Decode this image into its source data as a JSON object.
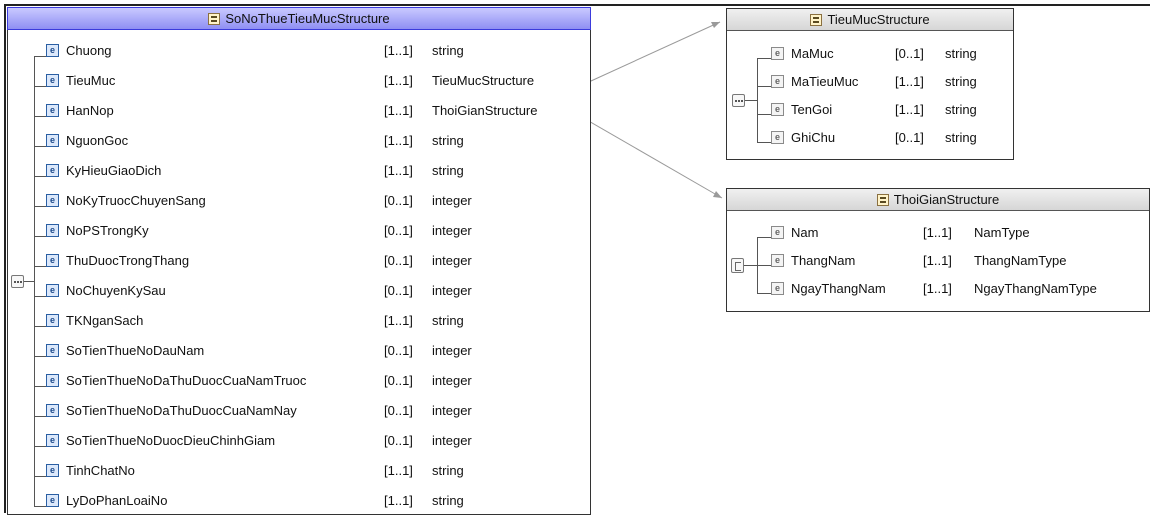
{
  "main": {
    "title": "SoNoThueTieuMucStructure",
    "elements": [
      {
        "name": "Chuong",
        "card": "[1..1]",
        "type": "string"
      },
      {
        "name": "TieuMuc",
        "card": "[1..1]",
        "type": "TieuMucStructure"
      },
      {
        "name": "HanNop",
        "card": "[1..1]",
        "type": "ThoiGianStructure"
      },
      {
        "name": "NguonGoc",
        "card": "[1..1]",
        "type": "string"
      },
      {
        "name": "KyHieuGiaoDich",
        "card": "[1..1]",
        "type": "string"
      },
      {
        "name": "NoKyTruocChuyenSang",
        "card": "[0..1]",
        "type": "integer"
      },
      {
        "name": "NoPSTrongKy",
        "card": "[0..1]",
        "type": "integer"
      },
      {
        "name": "ThuDuocTrongThang",
        "card": "[0..1]",
        "type": "integer"
      },
      {
        "name": "NoChuyenKySau",
        "card": "[0..1]",
        "type": "integer"
      },
      {
        "name": "TKNganSach",
        "card": "[1..1]",
        "type": "string"
      },
      {
        "name": "SoTienThueNoDauNam",
        "card": "[0..1]",
        "type": "integer"
      },
      {
        "name": "SoTienThueNoDaThuDuocCuaNamTruoc",
        "card": "[0..1]",
        "type": "integer"
      },
      {
        "name": "SoTienThueNoDaThuDuocCuaNamNay",
        "card": "[0..1]",
        "type": "integer"
      },
      {
        "name": "SoTienThueNoDuocDieuChinhGiam",
        "card": "[0..1]",
        "type": "integer"
      },
      {
        "name": "TinhChatNo",
        "card": "[1..1]",
        "type": "string"
      },
      {
        "name": "LyDoPhanLoaiNo",
        "card": "[1..1]",
        "type": "string"
      }
    ]
  },
  "tieumuc": {
    "title": "TieuMucStructure",
    "elements": [
      {
        "name": "MaMuc",
        "card": "[0..1]",
        "type": "string"
      },
      {
        "name": "MaTieuMuc",
        "card": "[1..1]",
        "type": "string"
      },
      {
        "name": "TenGoi",
        "card": "[1..1]",
        "type": "string"
      },
      {
        "name": "GhiChu",
        "card": "[0..1]",
        "type": "string"
      }
    ]
  },
  "thoigian": {
    "title": "ThoiGianStructure",
    "elements": [
      {
        "name": "Nam",
        "card": "[1..1]",
        "type": "NamType"
      },
      {
        "name": "ThangNam",
        "card": "[1..1]",
        "type": "ThangNamType"
      },
      {
        "name": "NgayThangNam",
        "card": "[1..1]",
        "type": "NgayThangNamType"
      }
    ]
  },
  "icon_letter": "e",
  "colors": {
    "main_header": "#9d9df5",
    "element_icon": "#2b5fa3"
  }
}
